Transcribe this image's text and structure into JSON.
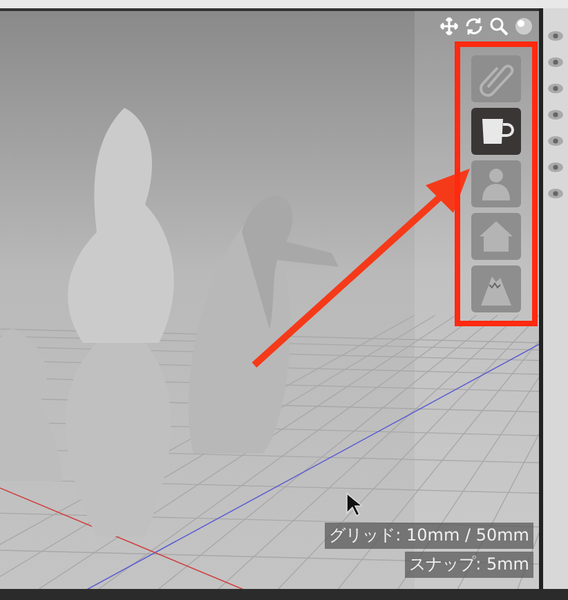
{
  "viewport_tools": [
    {
      "kind": "move"
    },
    {
      "kind": "rotate"
    },
    {
      "kind": "zoom"
    },
    {
      "kind": "shading"
    }
  ],
  "category_panel": {
    "highlighted": true,
    "items": [
      {
        "kind": "clip",
        "selected": false
      },
      {
        "kind": "cup",
        "selected": true
      },
      {
        "kind": "person",
        "selected": false
      },
      {
        "kind": "house",
        "selected": false
      },
      {
        "kind": "mountain",
        "selected": false
      }
    ]
  },
  "status": {
    "grid": "グリッド: 10mm / 50mm",
    "snap": "スナップ: 5mm"
  }
}
